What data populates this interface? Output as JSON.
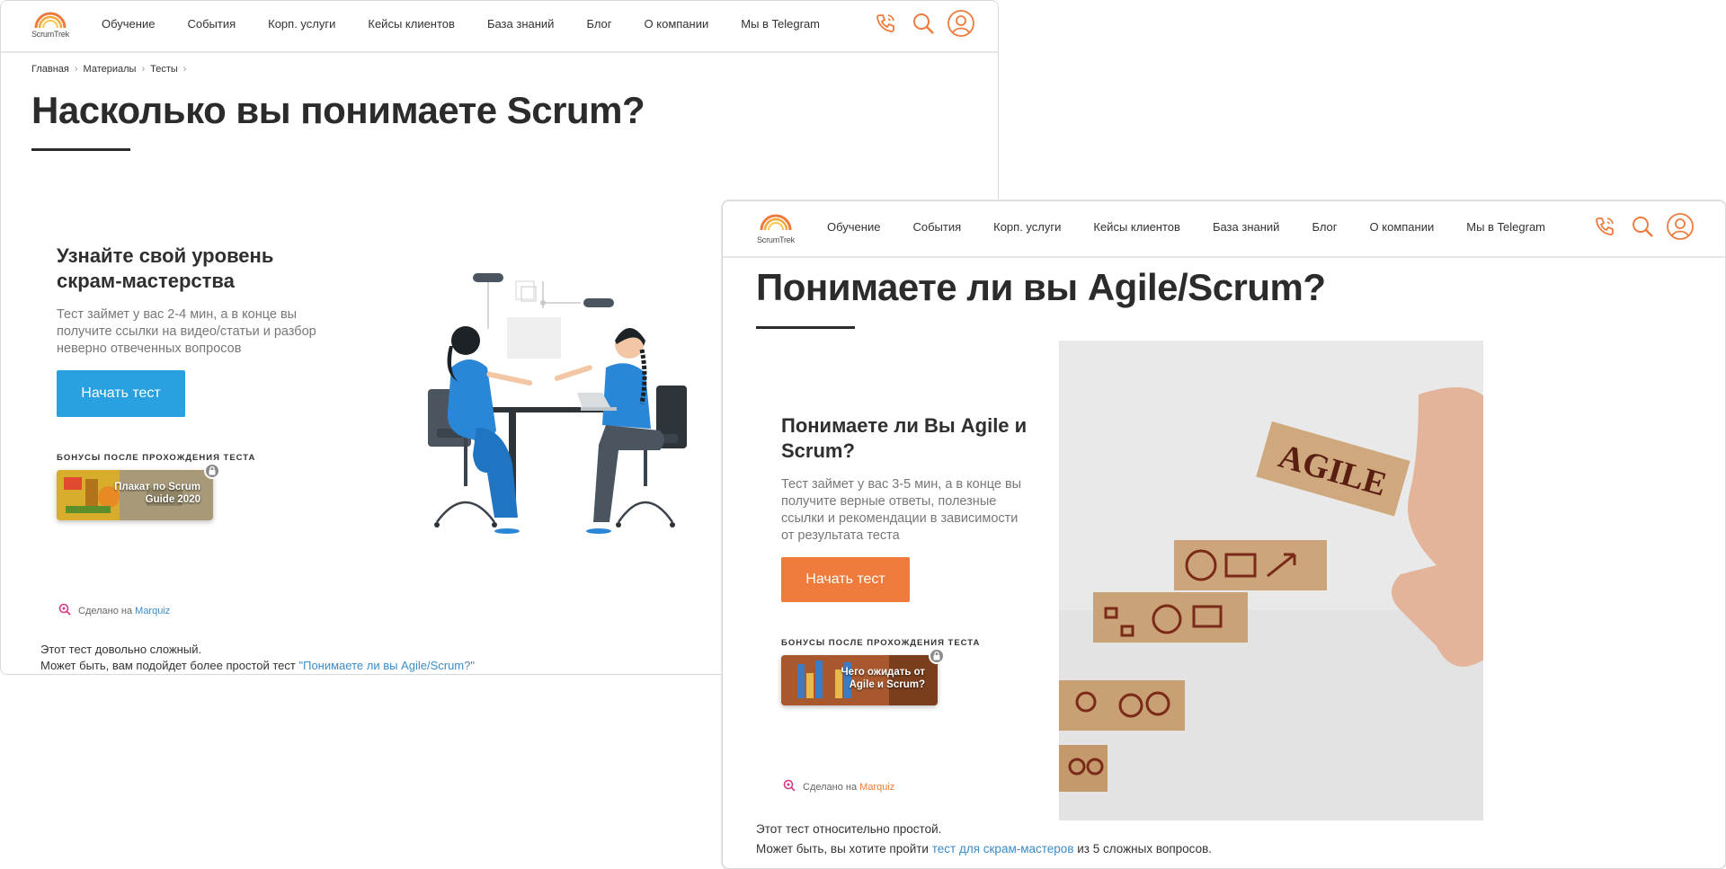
{
  "shot1": {
    "logo_text": "ScrumTrek",
    "nav": [
      "Обучение",
      "События",
      "Корп. услуги",
      "Кейсы клиентов",
      "База знаний",
      "Блог",
      "О компании",
      "Мы в Telegram"
    ],
    "breadcrumbs": [
      "Главная",
      "Материалы",
      "Тесты"
    ],
    "title": "Насколько вы понимаете Scrum?",
    "card": {
      "heading": "Узнайте свой уровень скрам-мастерства",
      "description": "Тест займет у вас 2-4 мин, а в конце вы получите ссылки на видео/статьи и разбор неверно отвеченных вопросов",
      "button": "Начать тест",
      "bonus_label": "БОНУСЫ ПОСЛЕ ПРОХОЖДЕНИЯ ТЕСТА",
      "bonus_title": "Плакат по Scrum Guide 2020"
    },
    "made_with": "Сделано на",
    "made_with_link": "Marquiz",
    "note_line1": "Этот тест довольно сложный.",
    "note_line2_prefix": "Может быть, вам подойдет более простой тест ",
    "note_line2_link": "\"Понимаете ли вы Agile/Scrum?\""
  },
  "shot2": {
    "logo_text": "ScrumTrek",
    "nav": [
      "Обучение",
      "События",
      "Корп. услуги",
      "Кейсы клиентов",
      "База знаний",
      "Блог",
      "О компании",
      "Мы в Telegram"
    ],
    "title": "Понимаете ли вы Agile/Scrum?",
    "card": {
      "heading": "Понимаете ли Вы Agile и Scrum?",
      "description": "Тест займет у вас 3-5 мин, а в конце вы получите верные ответы, полезные ссылки и рекомендации в зависимости от результата теста",
      "button": "Начать тест",
      "bonus_label": "БОНУСЫ ПОСЛЕ ПРОХОЖДЕНИЯ ТЕСТА",
      "bonus_title": "Чего ожидать от Agile и Scrum?"
    },
    "photo_word": "AGILE",
    "made_with": "Сделано на",
    "made_with_link": "Marquiz",
    "note_line1": "Этот тест относительно простой.",
    "note_line2_prefix": "Может быть, вы хотите пройти ",
    "note_line2_link": "тест для скрам-мастеров",
    "note_line2_suffix": " из 5 сложных вопросов."
  },
  "colors": {
    "accent_orange": "#ee7a3c",
    "accent_blue": "#29a0e0",
    "link_blue": "#3a8cc9",
    "text_dark": "#2b2b2b"
  },
  "icons": [
    "phone-icon",
    "search-icon",
    "user-icon",
    "lock-icon",
    "marquiz-icon",
    "chevron-right-icon"
  ]
}
